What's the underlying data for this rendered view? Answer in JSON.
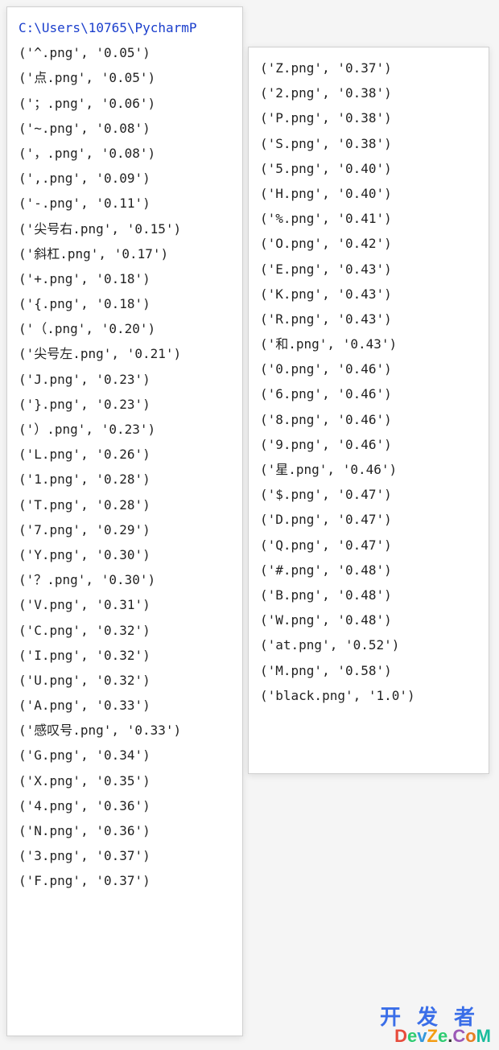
{
  "path": "C:\\Users\\10765\\PycharmP",
  "left_lines": [
    "('^.png', '0.05')",
    "('点.png', '0.05')",
    "('；.png', '0.06')",
    "('~.png', '0.08')",
    "('，.png', '0.08')",
    "(',.png', '0.09')",
    "('-.png', '0.11')",
    "('尖号右.png', '0.15')",
    "('斜杠.png', '0.17')",
    "('+.png', '0.18')",
    "('{.png', '0.18')",
    "('（.png', '0.20')",
    "('尖号左.png', '0.21')",
    "('J.png', '0.23')",
    "('}.png', '0.23')",
    "('）.png', '0.23')",
    "('L.png', '0.26')",
    "('1.png', '0.28')",
    "('T.png', '0.28')",
    "('7.png', '0.29')",
    "('Y.png', '0.30')",
    "('？.png', '0.30')",
    "('V.png', '0.31')",
    "('C.png', '0.32')",
    "('I.png', '0.32')",
    "('U.png', '0.32')",
    "('A.png', '0.33')",
    "('感叹号.png', '0.33')",
    "('G.png', '0.34')",
    "('X.png', '0.35')",
    "('4.png', '0.36')",
    "('N.png', '0.36')",
    "('3.png', '0.37')",
    "('F.png', '0.37')"
  ],
  "right_lines": [
    "('Z.png', '0.37')",
    "('2.png', '0.38')",
    "('P.png', '0.38')",
    "('S.png', '0.38')",
    "('5.png', '0.40')",
    "('H.png', '0.40')",
    "('%.png', '0.41')",
    "('O.png', '0.42')",
    "('E.png', '0.43')",
    "('K.png', '0.43')",
    "('R.png', '0.43')",
    "('和.png', '0.43')",
    "('0.png', '0.46')",
    "('6.png', '0.46')",
    "('8.png', '0.46')",
    "('9.png', '0.46')",
    "('星.png', '0.46')",
    "('$.png', '0.47')",
    "('D.png', '0.47')",
    "('Q.png', '0.47')",
    "('#.png', '0.48')",
    "('B.png', '0.48')",
    "('W.png', '0.48')",
    "('at.png', '0.52')",
    "('M.png', '0.58')",
    "('black.png', '1.0')"
  ],
  "watermark": {
    "cn": "开发者",
    "en": "DevZe.CoM"
  }
}
